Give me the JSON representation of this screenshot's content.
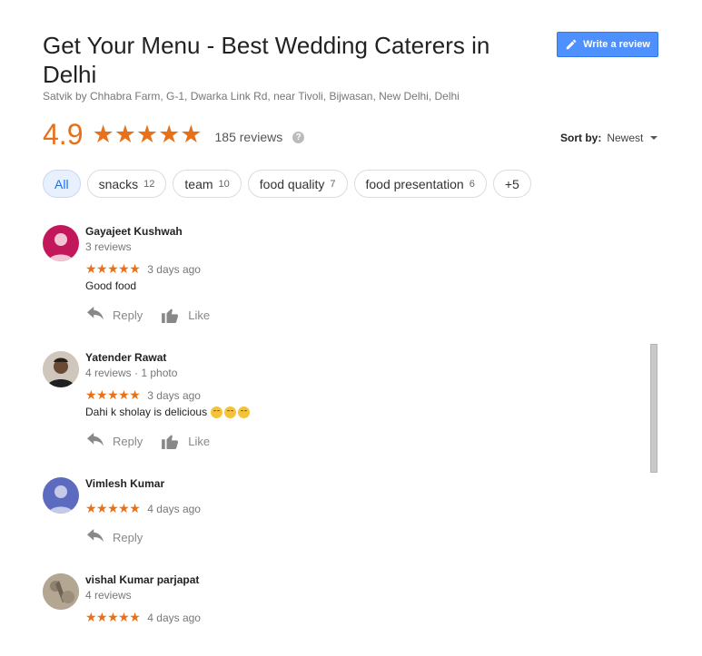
{
  "header": {
    "title": "Get Your Menu - Best Wedding Caterers in Delhi",
    "address": "Satvik by Chhabra Farm, G-1, Dwarka Link Rd, near Tivoli, Bijwasan, New Delhi, Delhi",
    "write_review_label": "Write a review"
  },
  "summary": {
    "rating": "4.9",
    "stars": "★★★★★",
    "review_count": "185 reviews",
    "help_glyph": "?"
  },
  "sort": {
    "label": "Sort by:",
    "value": "Newest"
  },
  "chips": [
    {
      "label": "All",
      "count": ""
    },
    {
      "label": "snacks",
      "count": "12"
    },
    {
      "label": "team",
      "count": "10"
    },
    {
      "label": "food quality",
      "count": "7"
    },
    {
      "label": "food presentation",
      "count": "6"
    },
    {
      "label": "+5",
      "count": ""
    }
  ],
  "actions": {
    "reply": "Reply",
    "like": "Like"
  },
  "reviews": [
    {
      "name": "Gayajeet Kushwah",
      "meta": "3 reviews",
      "stars": "★★★★★",
      "time": "3 days ago",
      "text": "Good food",
      "avatar_color": "#c2185b"
    },
    {
      "name": "Yatender Rawat",
      "meta": "4 reviews · 1 photo",
      "stars": "★★★★★",
      "time": "3 days ago",
      "text": "Dahi k sholay is delicious",
      "avatar_color": "#5a4a3a"
    },
    {
      "name": "Vimlesh Kumar",
      "meta": "",
      "stars": "★★★★★",
      "time": "4 days ago",
      "text": "",
      "avatar_color": "#5c6bc0"
    },
    {
      "name": "vishal Kumar parjapat",
      "meta": "4 reviews",
      "stars": "★★★★★",
      "time": "4 days ago",
      "text": "",
      "avatar_color": "#a89a86"
    }
  ],
  "colors": {
    "accent_orange": "#e7711b",
    "button_blue": "#4d90fe"
  }
}
